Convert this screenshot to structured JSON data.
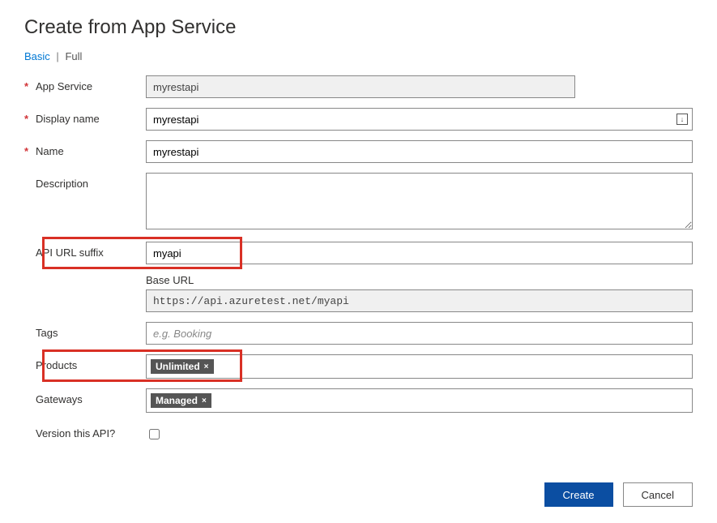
{
  "title": "Create from App Service",
  "tabs": {
    "basic": "Basic",
    "full": "Full",
    "sep": "|"
  },
  "labels": {
    "app_service": "App Service",
    "display_name": "Display name",
    "name": "Name",
    "description": "Description",
    "api_url_suffix": "API URL suffix",
    "base_url": "Base URL",
    "tags": "Tags",
    "products": "Products",
    "gateways": "Gateways",
    "version": "Version this API?"
  },
  "values": {
    "app_service": "myrestapi",
    "display_name": "myrestapi",
    "name": "myrestapi",
    "description": "",
    "api_url_suffix": "myapi",
    "base_url": "https://api.azuretest.net/myapi",
    "tags_placeholder": "e.g. Booking",
    "products_chip": "Unlimited",
    "gateways_chip": "Managed",
    "version_checked": false
  },
  "required_marker": "*",
  "chip_close": "×",
  "buttons": {
    "create": "Create",
    "cancel": "Cancel"
  }
}
